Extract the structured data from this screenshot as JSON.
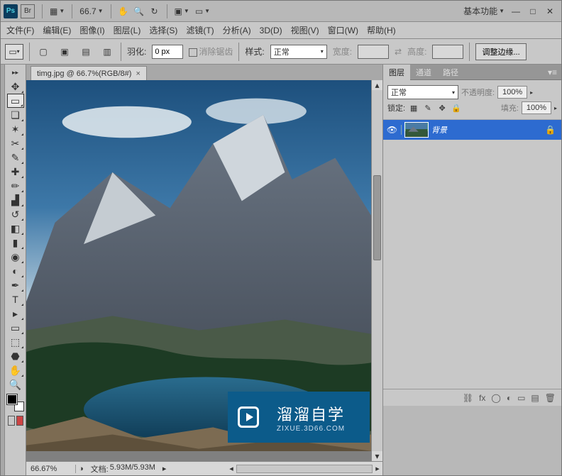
{
  "title_bar": {
    "ps_label": "Ps",
    "br_label": "Br",
    "zoom_display": "66.7",
    "workspace_label": "基本功能"
  },
  "menu": {
    "file": "文件(F)",
    "edit": "编辑(E)",
    "image": "图像(I)",
    "layer": "图层(L)",
    "select": "选择(S)",
    "filter": "滤镜(T)",
    "analysis": "分析(A)",
    "three_d": "3D(D)",
    "view": "视图(V)",
    "window": "窗口(W)",
    "help": "帮助(H)"
  },
  "options": {
    "feather_label": "羽化:",
    "feather_value": "0 px",
    "antialias_label": "消除锯齿",
    "style_label": "样式:",
    "style_value": "正常",
    "width_label": "宽度:",
    "height_label": "高度:",
    "refine_edge": "调整边缘..."
  },
  "document": {
    "tab_title": "timg.jpg @ 66.7%(RGB/8#)",
    "tab_close": "×"
  },
  "status": {
    "zoom": "66.67%",
    "doc_label": "文档:",
    "doc_value": "5.93M/5.93M"
  },
  "panels": {
    "tab_layers": "图层",
    "tab_channels": "通道",
    "tab_paths": "路径",
    "blend_mode": "正常",
    "opacity_label": "不透明度:",
    "opacity_value": "100%",
    "lock_label": "锁定:",
    "fill_label": "填充:",
    "fill_value": "100%",
    "layer0_name": "背景"
  },
  "watermark": {
    "big": "溜溜自学",
    "small": "ZIXUE.3D66.COM"
  }
}
